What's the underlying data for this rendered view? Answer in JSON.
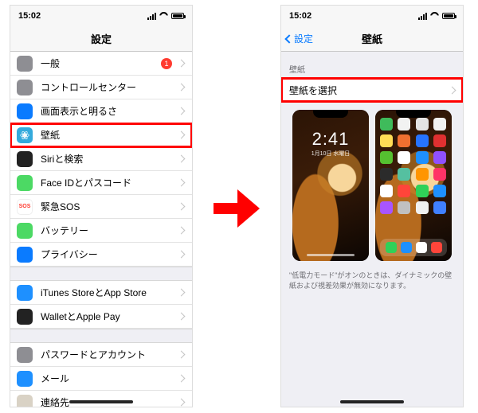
{
  "status": {
    "time": "15:02"
  },
  "left": {
    "title": "設定",
    "rows": [
      {
        "key": "general",
        "label": "一般",
        "icon": "ic-general",
        "badge": "1"
      },
      {
        "key": "cc",
        "label": "コントロールセンター",
        "icon": "ic-cc"
      },
      {
        "key": "display",
        "label": "画面表示と明るさ",
        "icon": "ic-display"
      },
      {
        "key": "wall",
        "label": "壁紙",
        "icon": "ic-wall",
        "highlight": true
      },
      {
        "key": "siri",
        "label": "Siriと検索",
        "icon": "ic-siri"
      },
      {
        "key": "face",
        "label": "Face IDとパスコード",
        "icon": "ic-face"
      },
      {
        "key": "sos",
        "label": "緊急SOS",
        "icon": "ic-sos"
      },
      {
        "key": "batt",
        "label": "バッテリー",
        "icon": "ic-batt"
      },
      {
        "key": "priv",
        "label": "プライバシー",
        "icon": "ic-priv"
      }
    ],
    "rows2": [
      {
        "key": "appstore",
        "label": "iTunes StoreとApp Store",
        "icon": "ic-appstore"
      },
      {
        "key": "wallet",
        "label": "WalletとApple Pay",
        "icon": "ic-wallet"
      }
    ],
    "rows3": [
      {
        "key": "pass",
        "label": "パスワードとアカウント",
        "icon": "ic-pass"
      },
      {
        "key": "mail",
        "label": "メール",
        "icon": "ic-mail"
      },
      {
        "key": "contacts",
        "label": "連絡先",
        "icon": "ic-contacts"
      }
    ]
  },
  "right": {
    "back": "設定",
    "title": "壁紙",
    "section": "壁紙",
    "choose": "壁紙を選択",
    "lock_time": "2:41",
    "lock_date": "1月10日 水曜日",
    "footer": "\"低電力モード\"がオンのときは、ダイナミックの壁紙および視差効果が無効になります。"
  },
  "home_app_colors": [
    "#3fbb5b",
    "#f2f2f2",
    "#e4e4e4",
    "#f2f2f2",
    "#ffdd55",
    "#f07030",
    "#2673ff",
    "#e03030",
    "#55c030",
    "#ffffff",
    "#1e90ff",
    "#9050ff",
    "#2b2b2b",
    "#55c0a0",
    "#ff9500",
    "#ff3366",
    "#ffffff",
    "#ff453a",
    "#30d158",
    "#1e90ff",
    "#a855ff",
    "#c0c0c0",
    "#f0f0f0",
    "#4080ff"
  ],
  "dock_app_colors": [
    "#30d158",
    "#1e90ff",
    "#ffffff",
    "#ff453a"
  ]
}
